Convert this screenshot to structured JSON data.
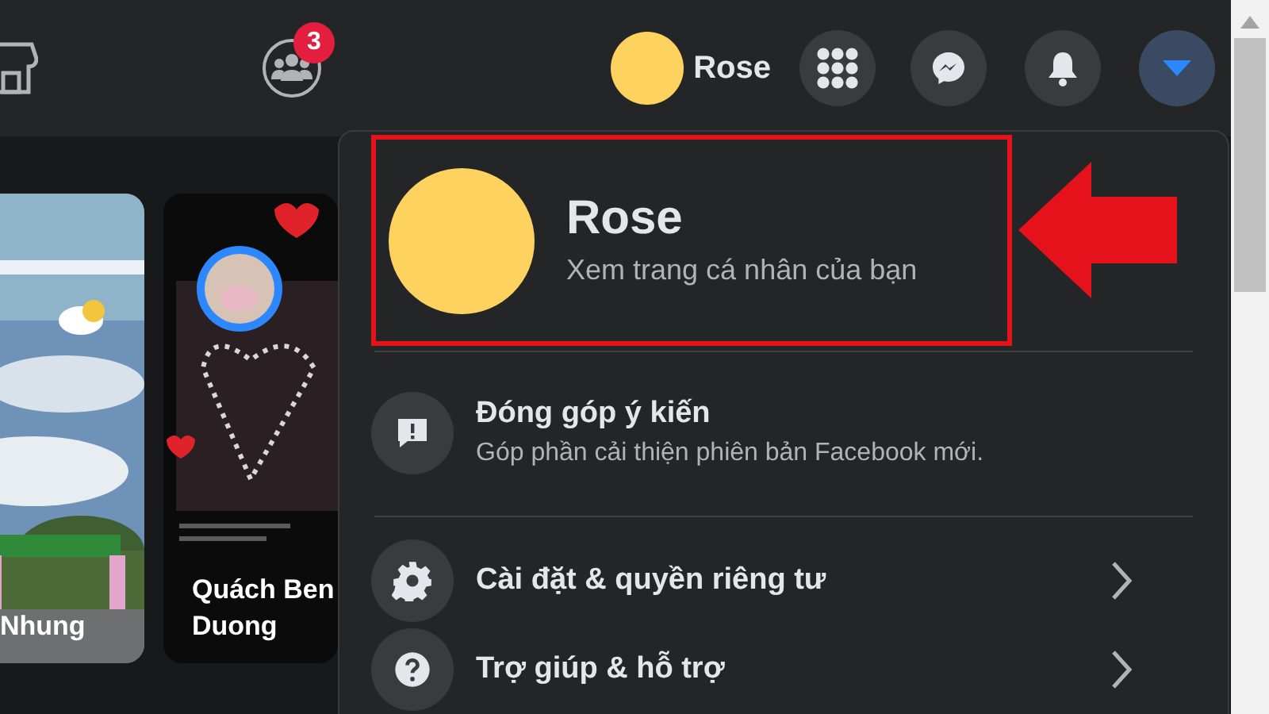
{
  "top_bar": {
    "groups_badge": "3",
    "profile_name": "Rose",
    "menu_open": true
  },
  "stories": [
    {
      "name": "Nhung"
    },
    {
      "name": "Quách Ben Duong"
    }
  ],
  "account_menu": {
    "profile": {
      "name": "Rose",
      "subtitle": "Xem trang cá nhân của bạn",
      "highlighted": true
    },
    "items": [
      {
        "title": "Đóng góp ý kiến",
        "subtitle": "Góp phần cải thiện phiên bản Facebook mới.",
        "has_submenu": false
      },
      {
        "title": "Cài đặt & quyền riêng tư",
        "has_submenu": true
      },
      {
        "title": "Trợ giúp & hỗ trợ",
        "has_submenu": true
      }
    ]
  }
}
